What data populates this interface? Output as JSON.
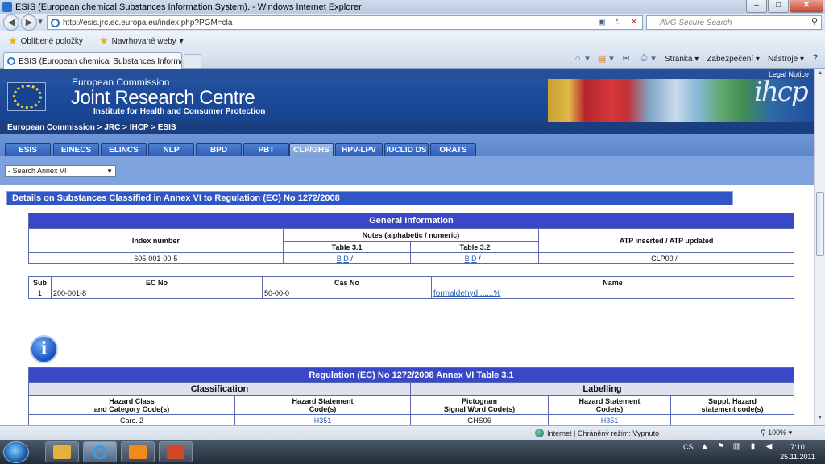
{
  "window": {
    "title": "ESIS (European chemical Substances Information System). - Windows Internet Explorer"
  },
  "browser": {
    "url": "http://esis.jrc.ec.europa.eu/index.php?PGM=cla",
    "search_placeholder": "AVG Secure Search",
    "favorites_label": "Oblíbené položky",
    "suggested_label": "Navrhované weby",
    "tab_title": "ESIS (European chemical Substances Information Syst...",
    "menu_page": "Stránka",
    "menu_security": "Zabezpečení",
    "menu_tools": "Nástroje"
  },
  "header": {
    "legal_notice": "Legal Notice",
    "org": "European Commission",
    "center": "Joint Research Centre",
    "institute": "Institute for Health and Consumer Protection",
    "breadcrumb": "European Commission > JRC > IHCP > ESIS",
    "logo_text": "ihcp"
  },
  "nav": {
    "tabs": [
      "ESIS",
      "EINECS",
      "ELINCS",
      "NLP",
      "BPD",
      "PBT",
      "CLP/GHS",
      "HPV-LPV",
      "IUCLID DS",
      "ORATS"
    ],
    "active": "CLP/GHS"
  },
  "search_select": {
    "value": "- Search Annex VI"
  },
  "details": {
    "title": "Details on Substances Classified in Annex VI to Regulation (EC) No 1272/2008",
    "general": {
      "heading": "General Information",
      "index_label": "Index number",
      "notes_label": "Notes (alphabetic / numeric)",
      "table31_label": "Table 3.1",
      "table32_label": "Table 3.2",
      "atp_label": "ATP inserted / ATP updated",
      "index_value": "605-001-00-5",
      "notes31": {
        "b": "B",
        "d": "D",
        "rest": " / -"
      },
      "notes32": {
        "b": "B",
        "d": "D",
        "rest": " / -"
      },
      "atp_value": "CLP00 / -"
    },
    "ids": {
      "headers": [
        "Sub",
        "EC No",
        "Cas No",
        "Name"
      ],
      "row": {
        "sub": "1",
        "ec": "200-001-8",
        "cas": "50-00-0",
        "name": "formaldehyd ......%"
      }
    },
    "reg": {
      "heading": "Regulation (EC) No 1272/2008 Annex VI Table 3.1",
      "classification": "Classification",
      "labelling": "Labelling",
      "cols": [
        "Hazard Class\nand Category Code(s)",
        "Hazard Statement\nCode(s)",
        "Pictogram\nSignal Word Code(s)",
        "Hazard Statement\nCode(s)",
        "Suppl. Hazard\nstatement code(s)"
      ],
      "row": [
        "Carc. 2",
        "H351",
        "GHS06",
        "H351",
        ""
      ]
    }
  },
  "status": {
    "zone": "Internet | Chráněný režim: Vypnuto",
    "zoom": "100%"
  },
  "taskbar": {
    "lang": "CS",
    "time": "7:10",
    "date": "25.11.2011"
  },
  "colors": {
    "banner": "#1f4d9c",
    "nav_tab": "#2f5fb6",
    "table_head": "#3a47c6",
    "link": "#2b5fb4"
  }
}
